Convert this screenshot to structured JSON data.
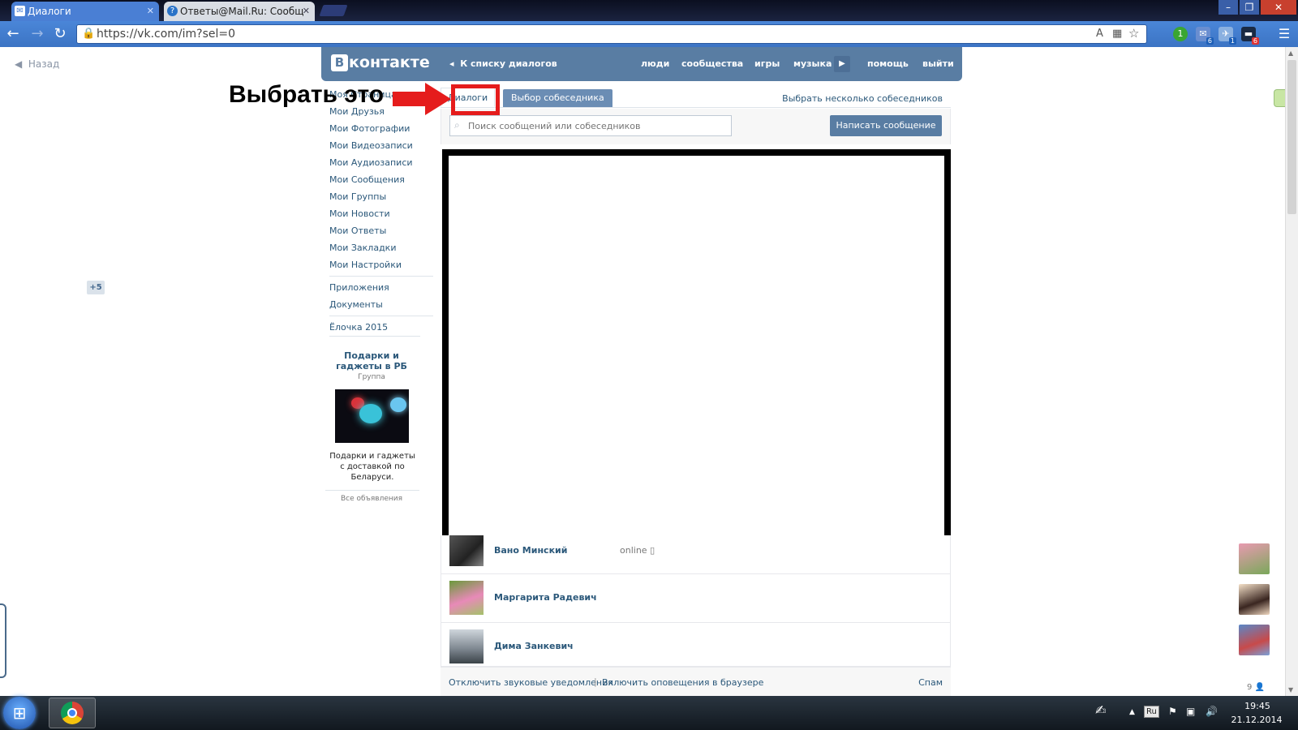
{
  "browser": {
    "tabs": [
      {
        "title": "Диалоги"
      },
      {
        "title": "Ответы@Mail.Ru: Сообщ"
      }
    ],
    "url": "https://vk.com/im?sel=0",
    "extension_badges": [
      "1",
      "6",
      "1",
      "6"
    ]
  },
  "page": {
    "back_label": "Назад"
  },
  "vk_header": {
    "logo_letter": "В",
    "logo_text": "контакте",
    "to_dialogs": "К списку диалогов",
    "nav": [
      "люди",
      "сообщества",
      "игры",
      "музыка",
      "помощь",
      "выйти"
    ]
  },
  "left_menu": {
    "items": [
      "Моя Страница",
      "Мои Друзья",
      "Мои Фотографии",
      "Мои Видеозаписи",
      "Мои Аудиозаписи",
      "Мои Сообщения",
      "Мои Группы",
      "Мои Новости",
      "Мои Ответы",
      "Мои Закладки",
      "Мои Настройки"
    ],
    "apps": "Приложения",
    "apps_badge": "+5",
    "documents": "Документы",
    "game": "Ёлочка 2015"
  },
  "ad": {
    "title": "Подарки и гаджеты в РБ",
    "type": "Группа",
    "text": "Подарки и гаджеты с доставкой по Беларуси.",
    "all_link": "Все объявления"
  },
  "messages": {
    "tab_dialogs": "Диалоги",
    "tab_choose": "Выбор собеседника",
    "choose_multiple": "Выбрать несколько собеседников",
    "search_placeholder": "Поиск сообщений или собеседников",
    "write_button": "Написать сообщение",
    "dialogs": [
      {
        "name": "Вано Минский",
        "status": "online"
      },
      {
        "name": "Маргарита Радевич",
        "status": ""
      },
      {
        "name": "Дима Занкевич",
        "status": ""
      }
    ],
    "footer": {
      "mute_sounds": "Отключить звуковые уведомления",
      "enable_browser_alerts": "Включить оповещения в браузере",
      "spam": "Спам"
    }
  },
  "annotation": {
    "text": "Выбрать это",
    "color": "#e51c1c"
  },
  "side_friends": {
    "count": "9"
  },
  "taskbar": {
    "language": "Ru",
    "time": "19:45",
    "date": "21.12.2014"
  },
  "colors": {
    "vk_header": "#597da3",
    "vk_link": "#2b587a",
    "browser_active_tab": "#4a7fd4"
  }
}
